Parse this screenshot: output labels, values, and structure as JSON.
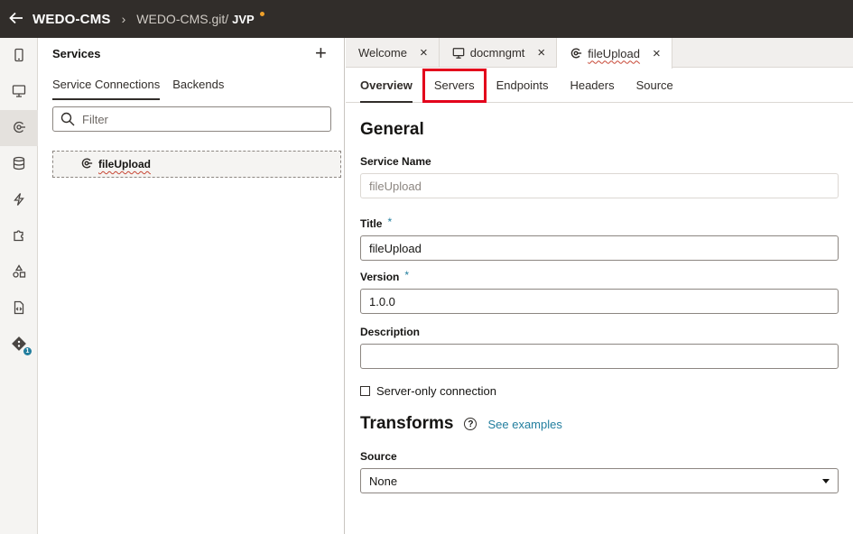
{
  "header": {
    "back_icon": "arrow-left-icon",
    "app_name": "WEDO-CMS",
    "separator": "›",
    "repo": "WEDO-CMS.git/",
    "branch": "JVP",
    "modified_dot_color": "#f0a12a"
  },
  "rail": {
    "items": [
      {
        "icon": "mobile-icon"
      },
      {
        "icon": "desktop-icon"
      },
      {
        "icon": "service-icon",
        "active": true
      },
      {
        "icon": "database-icon"
      },
      {
        "icon": "lightning-icon"
      },
      {
        "icon": "puzzle-icon"
      },
      {
        "icon": "shapes-icon"
      },
      {
        "icon": "source-file-icon"
      },
      {
        "icon": "git-icon",
        "badge": "1"
      }
    ]
  },
  "services_panel": {
    "title": "Services",
    "add_label": "+",
    "tabs": [
      "Service Connections",
      "Backends"
    ],
    "active_tab": "Service Connections",
    "filter_placeholder": "Filter",
    "items": [
      {
        "label": "fileUpload"
      }
    ]
  },
  "editor": {
    "tabs": [
      {
        "label": "Welcome",
        "close": "×"
      },
      {
        "label": "docmngmt",
        "close": "×",
        "icon": "desktop-icon"
      },
      {
        "label": "fileUpload",
        "close": "×",
        "icon": "service-icon",
        "active": true
      }
    ],
    "nav_tabs": [
      "Overview",
      "Servers",
      "Endpoints",
      "Headers",
      "Source"
    ],
    "active_nav": "Overview",
    "highlighted_nav": "Servers",
    "highlight_color": "#e3001b",
    "form": {
      "general_heading": "General",
      "service_name_label": "Service Name",
      "service_name_value": "fileUpload",
      "title_label": "Title",
      "title_value": "fileUpload",
      "version_label": "Version",
      "version_value": "1.0.0",
      "required_mark": "*",
      "description_label": "Description",
      "description_value": "",
      "server_only_label": "Server-only connection",
      "server_only_checked": false,
      "transforms_heading": "Transforms",
      "help_glyph": "?",
      "see_examples_link": "See examples",
      "source_label": "Source",
      "source_value": "None"
    }
  },
  "colors": {
    "header_bg": "#312d2a",
    "accent": "#227e9e",
    "error_underline": "#c74634"
  }
}
